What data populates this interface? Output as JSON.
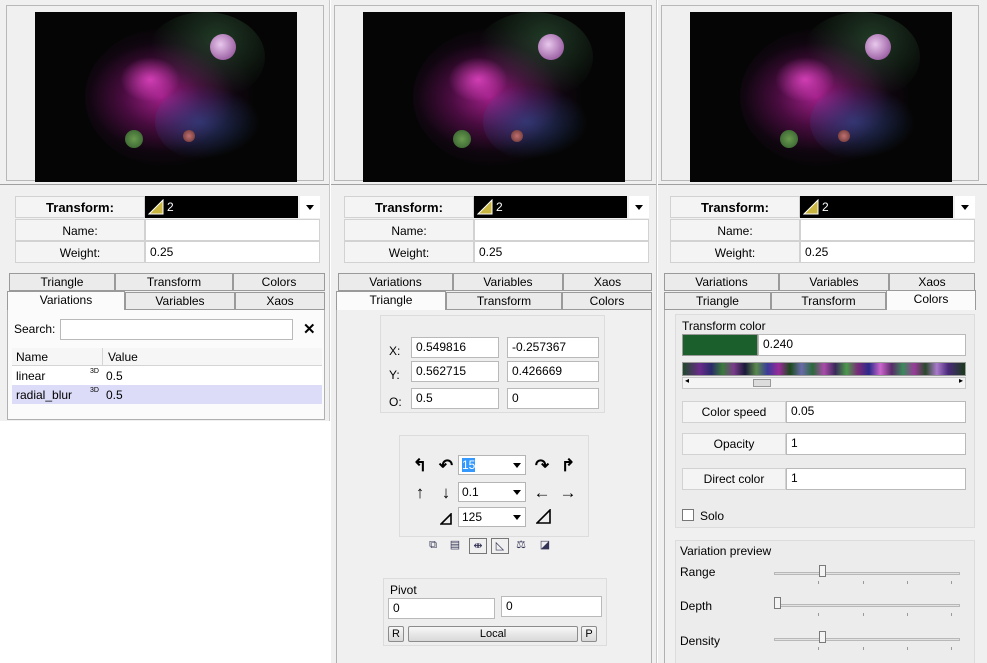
{
  "panel_left": {
    "transform": {
      "label": "Transform:",
      "value": "2"
    },
    "name": {
      "label": "Name:",
      "value": ""
    },
    "weight": {
      "label": "Weight:",
      "value": "0.25"
    },
    "tabs_back": [
      "Triangle",
      "Transform",
      "Colors"
    ],
    "tabs_front": [
      "Variations",
      "Variables",
      "Xaos"
    ],
    "active_tab": "Variations",
    "search_label": "Search:",
    "columns": [
      "Name",
      "Value"
    ],
    "rows": [
      {
        "name": "linear",
        "badge": "3D",
        "value": "0.5"
      },
      {
        "name": "radial_blur",
        "badge": "3D",
        "value": "0.5"
      }
    ]
  },
  "panel_mid": {
    "transform": {
      "label": "Transform:",
      "value": "2"
    },
    "name": {
      "label": "Name:",
      "value": ""
    },
    "weight": {
      "label": "Weight:",
      "value": "0.25"
    },
    "tabs_back": [
      "Variations",
      "Variables",
      "Xaos"
    ],
    "tabs_front": [
      "Triangle",
      "Transform",
      "Colors"
    ],
    "active_tab": "Triangle",
    "coords": {
      "x_label": "X:",
      "x1": "0.549816",
      "x2": "-0.257367",
      "y_label": "Y:",
      "y1": "0.562715",
      "y2": "0.426669",
      "o_label": "O:",
      "o1": "0.5",
      "o2": "0"
    },
    "rotate_value": "15",
    "move_value": "0.1",
    "scale_value": "125",
    "pivot": {
      "title": "Pivot",
      "x": "0",
      "y": "0",
      "r_label": "R",
      "local_label": "Local",
      "p_label": "P"
    }
  },
  "panel_right": {
    "transform": {
      "label": "Transform:",
      "value": "2"
    },
    "name": {
      "label": "Name:",
      "value": ""
    },
    "weight": {
      "label": "Weight:",
      "value": "0.25"
    },
    "tabs_back": [
      "Variations",
      "Variables",
      "Xaos"
    ],
    "tabs_front": [
      "Triangle",
      "Transform",
      "Colors"
    ],
    "active_tab": "Colors",
    "transform_color_title": "Transform color",
    "color_value": "0.240",
    "swatch_color": "#1a5f2c",
    "color_speed": {
      "label": "Color speed",
      "value": "0.05"
    },
    "opacity": {
      "label": "Opacity",
      "value": "1"
    },
    "direct_color": {
      "label": "Direct color",
      "value": "1"
    },
    "solo_label": "Solo",
    "solo_checked": false,
    "variation_preview": {
      "title": "Variation preview",
      "range_label": "Range",
      "range_level": 0.25,
      "depth_label": "Depth",
      "depth_level": 0.0,
      "density_label": "Density",
      "density_level": 0.25
    }
  },
  "colors": {
    "accent_magenta": "#c02fa0",
    "selection": "#dcdcf8",
    "selected_text_bg": "#3399ff"
  }
}
